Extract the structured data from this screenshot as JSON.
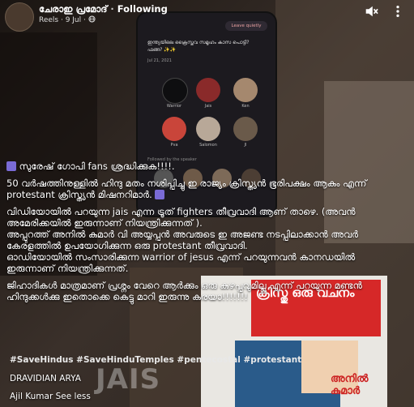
{
  "header": {
    "author": "ചേരാഇ പ്രമോദ്",
    "following": "Following",
    "meta": "Reels · 9 Jul ·"
  },
  "phone": {
    "leave_label": "Leave quietly",
    "question": "ഇന്ത്യയിലെ ക്രൈസ്തവ സമൂഹം കാസ പൊട്ടി? ഫങ്ങ? ✨✨",
    "date": "Jul 21, 2021",
    "speakers": [
      "Warrior",
      "Jais",
      "Ken",
      "Pva",
      "Salomon",
      "JI"
    ],
    "followed": "Followed by the speaker"
  },
  "post": {
    "line1": "സുരേഷ് ഗോപി fans ശ്രദ്ധിക്കുക!!!!.",
    "line2": "50 വർഷത്തിനുള്ളിൽ ഹിന്ദു മതം നശിപ്പിച്ചു ഇ രാജ്യം ക്രിസ്ത്യൻ ഭൂരിപക്ഷം ആകും എന്ന് protestant ക്രിസ്ത്യൻ മിഷനറിമാർ.",
    "line3": "വിഡിയോയിൽ പറയുന്ന jais എന്ന ട്രൂത് fighters തീവ്രവാദി ആണ് താഴെ. (അവൻ അമേരിക്കയിൽ ഇരുന്നാണ് നിയന്ത്രിക്കുന്നത് ).",
    "line4": "അപ്പുറത്ത് അനിൽ കുമാർ വി അയ്യപ്പൻ അവരുടെ ഇ അജണ്ട നടപ്പിലാക്കാൻ അവർ കേരളത്തിൽ ഉപയോഗിക്കുന്ന ഒരു protestant തീവ്രവാദി.",
    "line5": "ഓഡിയോയിൽ സംസാരിക്കുന്ന warrior of jesus എന്ന് പറയുന്നവൻ കാനഡയിൽ ഇരുന്നാണ് നിയന്ത്രിക്കുന്നത്.",
    "line6": "ജിഹാദികൾ മാത്രമാണ് പ്രശ്നം വേറെ ആർക്കും ഒരു കുഴപ്പവുമില്ല എന്ന് പറയുന്ന മണ്ടൻ ഹിന്ദുക്കൾക്കു ഇതൊക്കെ കെട്ടു മാറി ഇരുന്നു കരയാ!!!!!!!",
    "hashtags": "#SaveHindus #SaveHinduTemples #pentecostal #protestant",
    "group": "DRAVIDIAN ARYA",
    "credit": "Ajil Kumar See less"
  },
  "overlay": {
    "jais": "JAIS",
    "poster_top": "ക്രിസ്തു ഒരു വചനം",
    "poster_name": "അനിൽ കുമാർ"
  },
  "colors": {
    "accent": "#7a6bd6",
    "background": "#2a2420"
  },
  "icons": [
    "back-icon",
    "globe-icon",
    "mute-icon",
    "more-icon",
    "cross-icon"
  ]
}
